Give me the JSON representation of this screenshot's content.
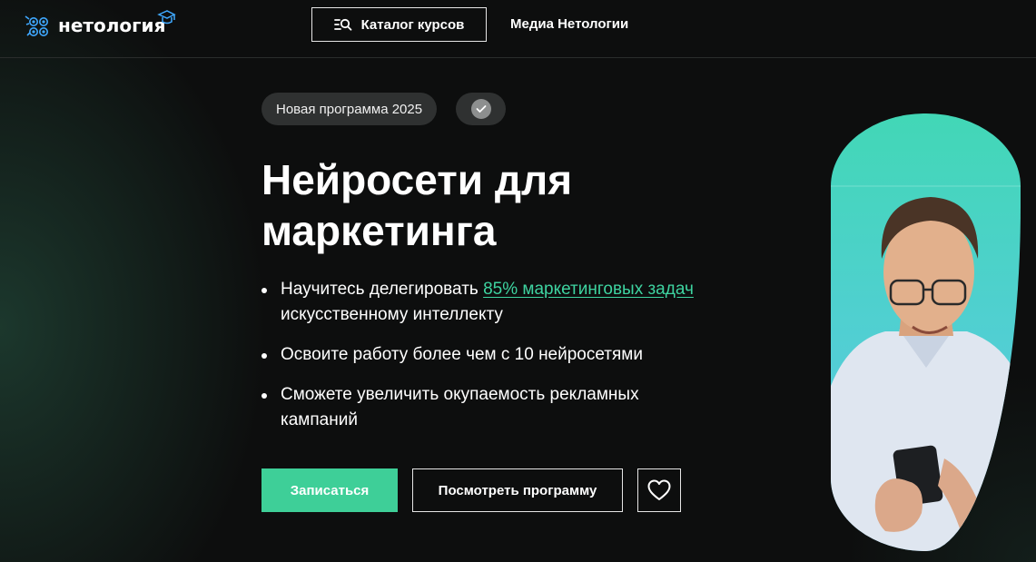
{
  "header": {
    "logo_text": "нетология",
    "catalog_label": "Каталог курсов",
    "media_label": "Медиа Нетологии"
  },
  "hero": {
    "badge": "Новая программа 2025",
    "title_line1": "Нейросети для",
    "title_line2": "маркетинга",
    "bullets": [
      {
        "before": "Научитесь делегировать ",
        "highlight": "85% маркетинговых задач",
        "after": " искусственному интеллекту"
      },
      {
        "text": "Освоите работу более чем с 10 нейросетями"
      },
      {
        "text": "Сможете увеличить окупаемость рекламных кампаний"
      }
    ],
    "cta_primary": "Записаться",
    "cta_secondary": "Посмотреть программу"
  },
  "colors": {
    "accent": "#3ecf98",
    "background": "#0d0e0e",
    "badge_bg": "#2f3131"
  },
  "icons": {
    "logo": "netology-logo-icon",
    "catalog": "catalog-search-icon",
    "badge": "check-icon",
    "favorite": "heart-icon"
  }
}
